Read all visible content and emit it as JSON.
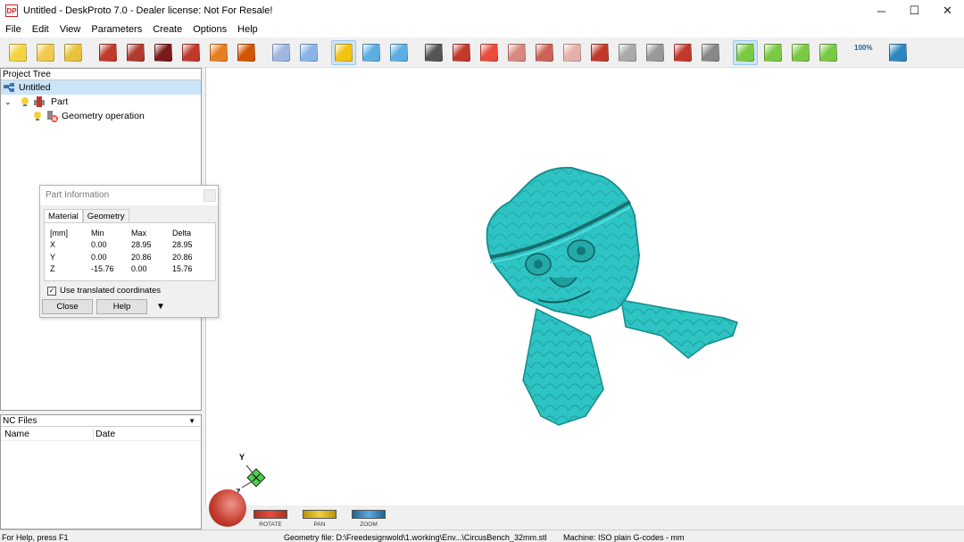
{
  "window": {
    "title": "Untitled - DeskProto 7.0 - Dealer license: Not For Resale!",
    "icon_text": "DP",
    "controls": [
      "─",
      "☐",
      "✕"
    ]
  },
  "menu": [
    "File",
    "Edit",
    "View",
    "Parameters",
    "Create",
    "Options",
    "Help"
  ],
  "toolbar": {
    "zoom_label": "100%",
    "buttons": [
      {
        "name": "new-project-icon",
        "color": "#f5d442"
      },
      {
        "name": "open-project-icon",
        "color": "#f2c94c"
      },
      {
        "name": "save-project-icon",
        "color": "#e8c23a"
      },
      {
        "name": "sep"
      },
      {
        "name": "wizard-d-icon",
        "color": "#c0392b"
      },
      {
        "name": "geometry-wizard-icon",
        "color": "#b03a2e"
      },
      {
        "name": "image-wizard-icon",
        "color": "#7a1a1a"
      },
      {
        "name": "vector-wizard-icon",
        "color": "#c0392b"
      },
      {
        "name": "d-wizard-icon",
        "color": "#e67e22"
      },
      {
        "name": "save-nc-icon",
        "color": "#d35400"
      },
      {
        "name": "sep"
      },
      {
        "name": "eraser-icon",
        "color": "#9fb6e0"
      },
      {
        "name": "inspect-icon",
        "color": "#8ab4e8"
      },
      {
        "name": "sep"
      },
      {
        "name": "info-icon",
        "color": "#f1c40f",
        "active": true
      },
      {
        "name": "layout-icon",
        "color": "#5dade2"
      },
      {
        "name": "screen-icon",
        "color": "#5dade2"
      },
      {
        "name": "sep"
      },
      {
        "name": "camera-icon",
        "color": "#555555"
      },
      {
        "name": "view-cube-1-icon",
        "color": "#c0392b"
      },
      {
        "name": "view-cube-2-icon",
        "color": "#e74c3c"
      },
      {
        "name": "view-cube-3-icon",
        "color": "#d98880"
      },
      {
        "name": "view-cube-4-icon",
        "color": "#cd6155"
      },
      {
        "name": "view-cube-5-icon",
        "color": "#e6b0aa"
      },
      {
        "name": "view-cube-6-icon",
        "color": "#c0392b"
      },
      {
        "name": "view-cube-7-icon",
        "color": "#aaaaaa"
      },
      {
        "name": "view-cube-8-icon",
        "color": "#999999"
      },
      {
        "name": "camera-reset-icon",
        "color": "#c0392b"
      },
      {
        "name": "camera-store-icon",
        "color": "#888888"
      },
      {
        "name": "sep"
      },
      {
        "name": "rotate-mode-icon",
        "color": "#7ac943",
        "active": true
      },
      {
        "name": "pan-mode-icon",
        "color": "#7ac943"
      },
      {
        "name": "zoom-mode-icon",
        "color": "#7ac943"
      },
      {
        "name": "zoom-window-icon",
        "color": "#7ac943"
      },
      {
        "name": "sep"
      },
      {
        "name": "zoom-100-icon",
        "color": "#7fb3d5"
      },
      {
        "name": "sep"
      },
      {
        "name": "help-book-icon",
        "color": "#2e86c1"
      }
    ]
  },
  "project_tree": {
    "header": "Project Tree",
    "items": [
      {
        "label": "Untitled",
        "icon": "project-icon",
        "level": 0,
        "selected": true
      },
      {
        "label": "Part",
        "icon": "part-icon",
        "level": 1
      },
      {
        "label": "Geometry operation",
        "icon": "geometry-operation-icon",
        "level": 2
      }
    ]
  },
  "nc_files": {
    "header": "NC Files",
    "columns": [
      "Name",
      "Date"
    ]
  },
  "part_info": {
    "title": "Part Information",
    "tabs": [
      "Material",
      "Geometry"
    ],
    "headers": [
      "[mm]",
      "Min",
      "Max",
      "Delta"
    ],
    "rows": [
      [
        "X",
        "0.00",
        "28.95",
        "28.95"
      ],
      [
        "Y",
        "0.00",
        "20.86",
        "20.86"
      ],
      [
        "Z",
        "-15.76",
        "0.00",
        "15.76"
      ]
    ],
    "checkbox_label": "Use translated coordinates",
    "checkbox_checked": true,
    "close_label": "Close",
    "help_label": "Help"
  },
  "viewport": {
    "model_color": "#2ec4c4",
    "axis_labels": {
      "y": "Y",
      "z": "Z"
    },
    "rotate_label": "ROTATE",
    "pan_label": "PAN",
    "zoom_label": "ZOOM"
  },
  "status": {
    "help": "For Help, press F1",
    "geometry": "Geometry file: D:\\Freedesignwold\\1.working\\Env...\\CircusBench_32mm.stl",
    "machine": "Machine: ISO plain G-codes - mm"
  }
}
